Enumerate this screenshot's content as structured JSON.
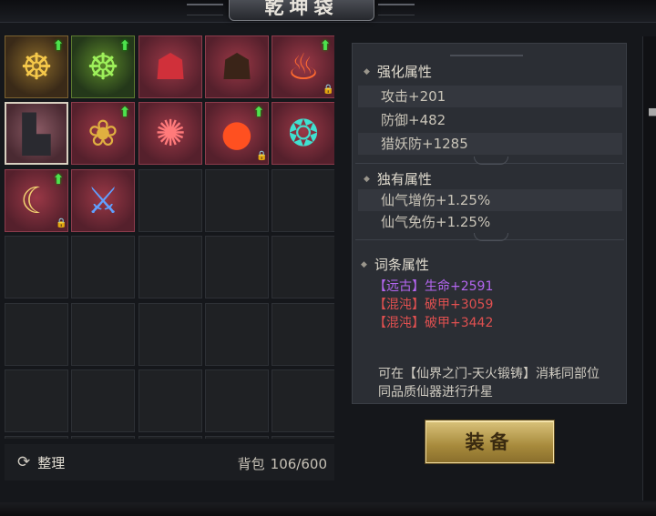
{
  "window": {
    "title": "乾坤袋"
  },
  "items": [
    {
      "name": "golden-wheel",
      "style": "gold",
      "glyph": "☸",
      "color": "#f5c84a",
      "upgrade": true,
      "locked": false
    },
    {
      "name": "green-wheel",
      "style": "green",
      "glyph": "☸",
      "color": "#9ef05a",
      "upgrade": true,
      "locked": false
    },
    {
      "name": "demon-mask-red",
      "style": "red",
      "glyph": "☗",
      "color": "#d0303a",
      "upgrade": false,
      "locked": false
    },
    {
      "name": "demon-mask-dark",
      "style": "red",
      "glyph": "☗",
      "color": "#3a2418",
      "upgrade": false,
      "locked": false
    },
    {
      "name": "fire-cauldron",
      "style": "red",
      "glyph": "♨",
      "color": "#ff6a30",
      "upgrade": true,
      "locked": true
    },
    {
      "name": "boots",
      "style": "sel",
      "glyph": "▙",
      "color": "#2a2a30",
      "upgrade": false,
      "locked": false
    },
    {
      "name": "golden-hair",
      "style": "red",
      "glyph": "❀",
      "color": "#e0b040",
      "upgrade": true,
      "locked": false
    },
    {
      "name": "red-demon-head",
      "style": "red",
      "glyph": "✺",
      "color": "#ff7a7a",
      "upgrade": false,
      "locked": false
    },
    {
      "name": "fire-orb",
      "style": "red",
      "glyph": "●",
      "color": "#ff5020",
      "upgrade": true,
      "locked": true
    },
    {
      "name": "cyan-beast",
      "style": "red",
      "glyph": "❂",
      "color": "#40e0d0",
      "upgrade": false,
      "locked": false
    },
    {
      "name": "crescent-staff",
      "style": "red",
      "glyph": "☾",
      "color": "#f0d070",
      "upgrade": true,
      "locked": true
    },
    {
      "name": "ice-sword",
      "style": "red",
      "glyph": "⚔",
      "color": "#60a0ff",
      "upgrade": false,
      "locked": false
    }
  ],
  "bottom": {
    "sort_label": "整理",
    "bag_label": "背包",
    "bag_count": "106/600"
  },
  "stats": {
    "enhance_title": "强化属性",
    "enhance": [
      "攻击+201",
      "防御+482",
      "猎妖防+1285"
    ],
    "unique_title": "独有属性",
    "unique": [
      "仙气增伤+1.25%",
      "仙气免伤+1.25%"
    ],
    "affix_title": "词条属性",
    "affixes": [
      {
        "bracket": "【远古】",
        "value": "生命+2591",
        "color": "#b466f0"
      },
      {
        "bracket": "【混沌】",
        "value": "破甲+3059",
        "color": "#e05050"
      },
      {
        "bracket": "【混沌】",
        "value": "破甲+3442",
        "color": "#e05050"
      }
    ],
    "note": "可在【仙界之门-天火锻铸】消耗同部位同品质仙器进行升星"
  },
  "equip_button": "装备",
  "icons": {
    "upgrade": "arrow-up-icon",
    "lock": "lock-icon",
    "sort": "refresh-icon",
    "section": "diamond-icon"
  }
}
